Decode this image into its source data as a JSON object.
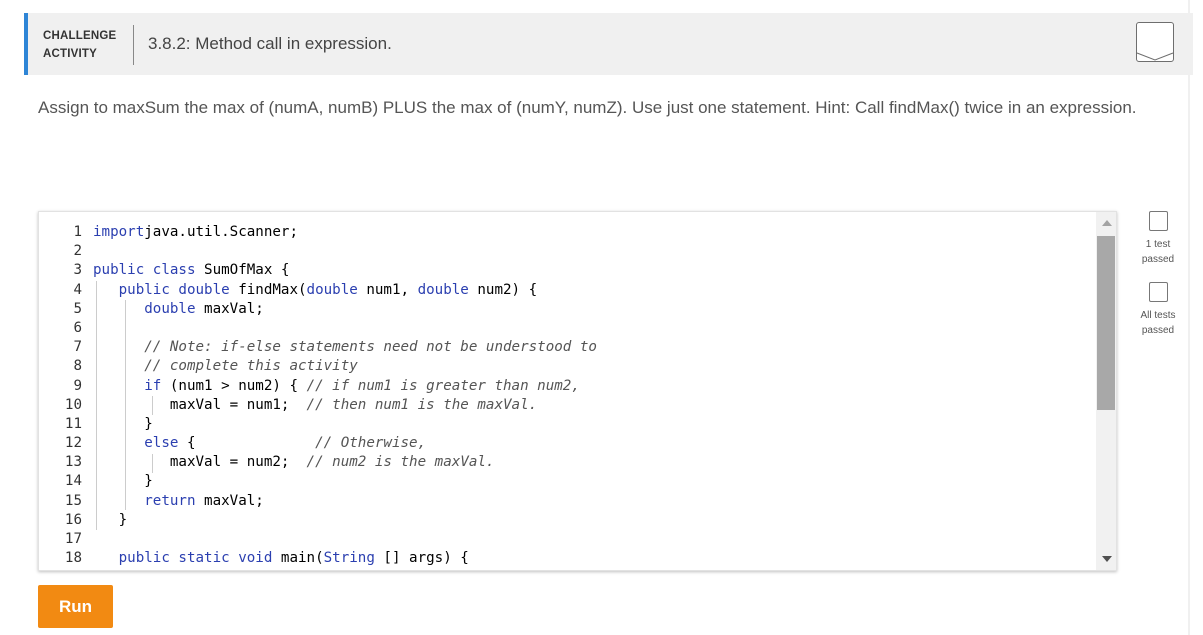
{
  "header": {
    "badge_line1": "CHALLENGE",
    "badge_line2": "ACTIVITY",
    "title": "3.8.2: Method call in expression."
  },
  "instructions": "Assign to maxSum the max of (numA, numB) PLUS the max of (numY, numZ). Use just one statement. Hint: Call findMax() twice in an expression.",
  "status": {
    "test1_line1": "1 test",
    "test1_line2": "passed",
    "all_line1": "All tests",
    "all_line2": "passed"
  },
  "code": {
    "lines": [
      {
        "n": "1",
        "segs": [
          [
            "kw",
            "import"
          ],
          [
            "",
            "java.util.Scanner;"
          ]
        ]
      },
      {
        "n": "2",
        "segs": []
      },
      {
        "n": "3",
        "segs": [
          [
            "kw",
            "public class"
          ],
          [
            "",
            " SumOfMax {"
          ]
        ]
      },
      {
        "n": "4",
        "segs": [
          [
            "",
            "   "
          ],
          [
            "kw",
            "public double"
          ],
          [
            "",
            " findMax("
          ],
          [
            "kw",
            "double"
          ],
          [
            "",
            " num1, "
          ],
          [
            "kw",
            "double"
          ],
          [
            "",
            " num2) {"
          ]
        ]
      },
      {
        "n": "5",
        "segs": [
          [
            "",
            "      "
          ],
          [
            "kw",
            "double"
          ],
          [
            "",
            " maxVal;"
          ]
        ]
      },
      {
        "n": "6",
        "segs": []
      },
      {
        "n": "7",
        "segs": [
          [
            "",
            "      "
          ],
          [
            "cm",
            "// Note: if-else statements need not be understood to"
          ]
        ]
      },
      {
        "n": "8",
        "segs": [
          [
            "",
            "      "
          ],
          [
            "cm",
            "// complete this activity"
          ]
        ]
      },
      {
        "n": "9",
        "segs": [
          [
            "",
            "      "
          ],
          [
            "kw",
            "if"
          ],
          [
            "",
            " (num1 > num2) { "
          ],
          [
            "cm",
            "// if num1 is greater than num2,"
          ]
        ]
      },
      {
        "n": "10",
        "segs": [
          [
            "",
            "         maxVal = num1;  "
          ],
          [
            "cm",
            "// then num1 is the maxVal."
          ]
        ]
      },
      {
        "n": "11",
        "segs": [
          [
            "",
            "      }"
          ]
        ]
      },
      {
        "n": "12",
        "segs": [
          [
            "",
            "      "
          ],
          [
            "kw",
            "else"
          ],
          [
            "",
            " {              "
          ],
          [
            "cm",
            "// Otherwise,"
          ]
        ]
      },
      {
        "n": "13",
        "segs": [
          [
            "",
            "         maxVal = num2;  "
          ],
          [
            "cm",
            "// num2 is the maxVal."
          ]
        ]
      },
      {
        "n": "14",
        "segs": [
          [
            "",
            "      }"
          ]
        ]
      },
      {
        "n": "15",
        "segs": [
          [
            "",
            "      "
          ],
          [
            "kw",
            "return"
          ],
          [
            "",
            " maxVal;"
          ]
        ]
      },
      {
        "n": "16",
        "segs": [
          [
            "",
            "   }"
          ]
        ]
      },
      {
        "n": "17",
        "segs": []
      },
      {
        "n": "18",
        "segs": [
          [
            "",
            "   "
          ],
          [
            "kw",
            "public static void"
          ],
          [
            "",
            " main("
          ],
          [
            "kw",
            "String"
          ],
          [
            "",
            " [] args) {"
          ]
        ]
      }
    ]
  },
  "run_label": "Run"
}
